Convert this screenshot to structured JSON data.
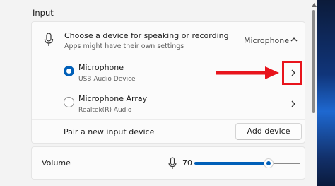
{
  "section": {
    "title": "Input"
  },
  "input_card": {
    "header": {
      "title": "Choose a device for speaking or recording",
      "subtitle": "Apps might have their own settings",
      "current_value": "Microphone",
      "expand_icon": "chevron-up-icon"
    },
    "devices": [
      {
        "name": "Microphone",
        "subtitle": "USB Audio Device",
        "selected": true,
        "icon": "chevron-right-icon"
      },
      {
        "name": "Microphone Array",
        "subtitle": "Realtek(R) Audio",
        "selected": false,
        "icon": "chevron-right-icon"
      }
    ],
    "pair": {
      "label": "Pair a new input device",
      "button_label": "Add device"
    }
  },
  "volume": {
    "label": "Volume",
    "value_text": "70",
    "level": 0.7,
    "icon": "microphone-icon"
  },
  "annotation": {
    "color": "#e8141c"
  },
  "colors": {
    "accent": "#005fb8",
    "background": "#f3f3f3",
    "card": "#fbfbfb"
  }
}
